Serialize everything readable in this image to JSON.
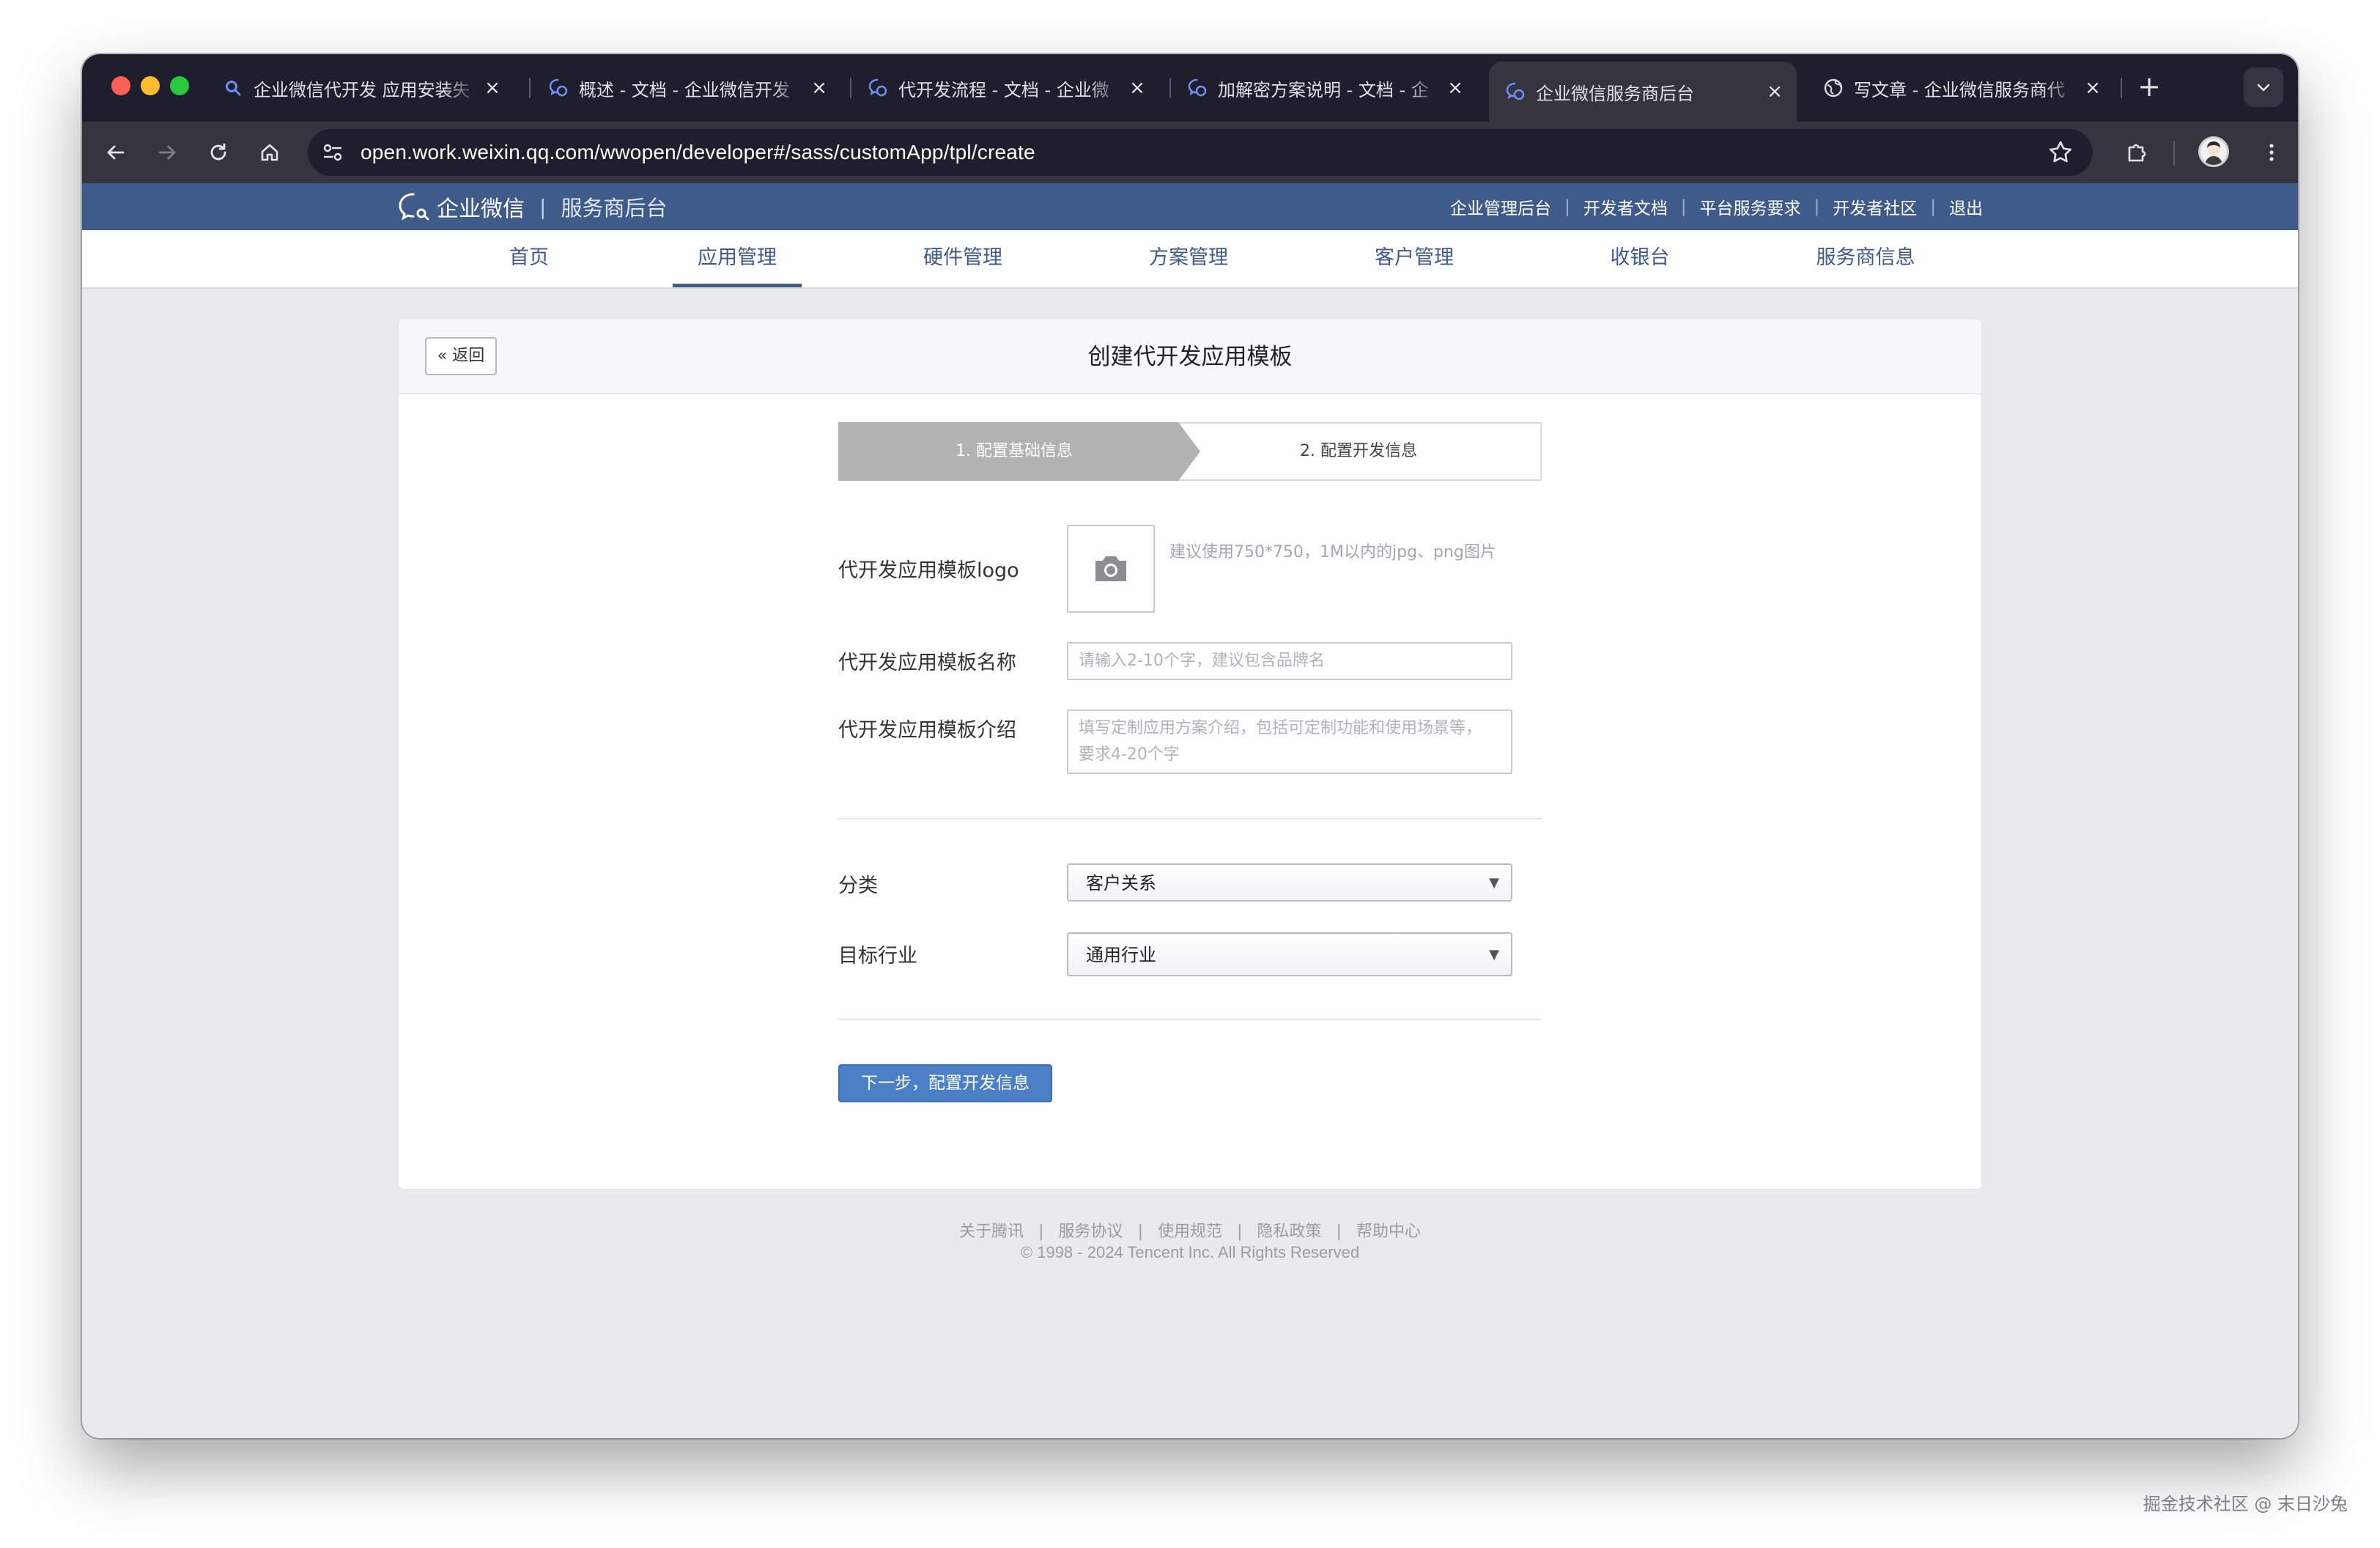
{
  "browser": {
    "tabs": [
      {
        "title": "企业微信代开发 应用安装失",
        "icon": "search-icon",
        "active": false
      },
      {
        "title": "概述 - 文档 - 企业微信开发",
        "icon": "wecom-icon",
        "active": false
      },
      {
        "title": "代开发流程 - 文档 - 企业微",
        "icon": "wecom-icon",
        "active": false
      },
      {
        "title": "加解密方案说明 - 文档 - 企",
        "icon": "wecom-icon",
        "active": false
      },
      {
        "title": "企业微信服务商后台",
        "icon": "wecom-icon",
        "active": true
      },
      {
        "title": "写文章 - 企业微信服务商代",
        "icon": "globe-icon",
        "active": false
      }
    ],
    "url": "open.work.weixin.qq.com/wwopen/developer#/sass/customApp/tpl/create"
  },
  "header": {
    "brand": "企业微信",
    "separator": "|",
    "subtitle": "服务商后台",
    "links": [
      "企业管理后台",
      "开发者文档",
      "平台服务要求",
      "开发者社区",
      "退出"
    ]
  },
  "nav": {
    "items": [
      "首页",
      "应用管理",
      "硬件管理",
      "方案管理",
      "客户管理",
      "收银台",
      "服务商信息"
    ],
    "active_index": 1
  },
  "card": {
    "back_label": "返回",
    "title": "创建代开发应用模板"
  },
  "steps": [
    {
      "label": "1. 配置基础信息",
      "active": true
    },
    {
      "label": "2. 配置开发信息",
      "active": false
    }
  ],
  "form": {
    "logo_label": "代开发应用模板logo",
    "logo_hint": "建议使用750*750，1M以内的jpg、png图片",
    "name_label": "代开发应用模板名称",
    "name_placeholder": "请输入2-10个字，建议包含品牌名",
    "intro_label": "代开发应用模板介绍",
    "intro_placeholder": "填写定制应用方案介绍，包括可定制功能和使用场景等，要求4-20个字",
    "category_label": "分类",
    "category_value": "客户关系",
    "industry_label": "目标行业",
    "industry_value": "通用行业",
    "next_label": "下一步，配置开发信息"
  },
  "footer": {
    "links": [
      "关于腾讯",
      "服务协议",
      "使用规范",
      "隐私政策",
      "帮助中心"
    ],
    "copyright": "© 1998 - 2024 Tencent Inc. All Rights Reserved"
  },
  "watermark": "掘金技术社区 @ 末日沙兔",
  "colors": {
    "header_bg": "#3e5b8a",
    "primary_button": "#4c80c6",
    "step_active": "#b2b2b2",
    "tabstrip_bg": "#1f1e2c"
  }
}
